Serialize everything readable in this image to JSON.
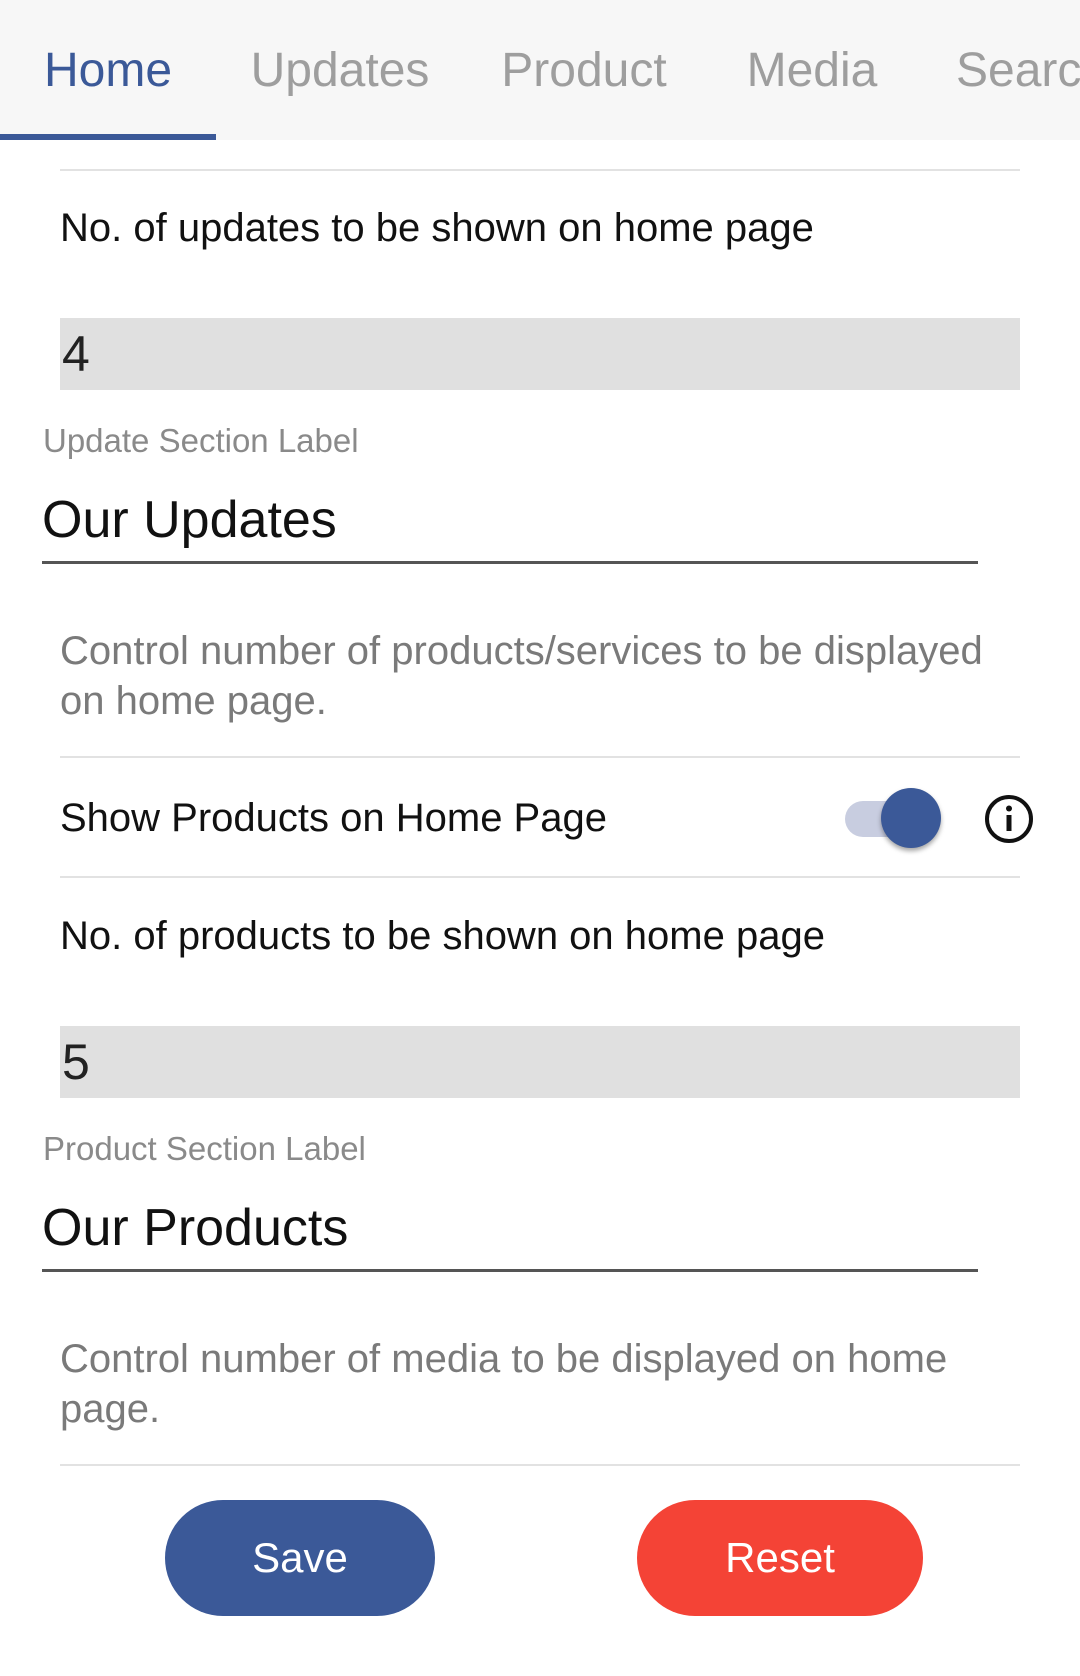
{
  "tabs": [
    {
      "label": "Home",
      "active": true
    },
    {
      "label": "Updates",
      "active": false
    },
    {
      "label": "Product",
      "active": false
    },
    {
      "label": "Media",
      "active": false
    },
    {
      "label": "Searc",
      "active": false
    }
  ],
  "updates": {
    "count_label": "No. of updates to be shown on home page",
    "count_value": "4",
    "section_label_caption": "Update Section Label",
    "section_label_value": "Our Updates"
  },
  "products": {
    "helper_text": "Control number of products/services to be displayed on home page.",
    "show_toggle_label": "Show Products on Home Page",
    "show_toggle_on": true,
    "count_label": "No. of products to be shown on home page",
    "count_value": "5",
    "section_label_caption": "Product Section Label",
    "section_label_value": "Our Products"
  },
  "media": {
    "helper_text": "Control number of media to be displayed on home page."
  },
  "actions": {
    "save_label": "Save",
    "reset_label": "Reset"
  },
  "colors": {
    "primary": "#3b5998",
    "danger": "#f44336",
    "field_bg": "#e0e0e0"
  },
  "icons": {
    "info": "info-circle-icon"
  }
}
